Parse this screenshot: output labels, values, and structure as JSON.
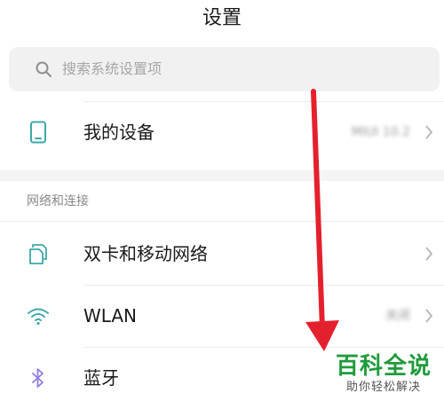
{
  "header": {
    "title": "设置"
  },
  "search": {
    "placeholder": "搜索系统设置项",
    "icon": "search-icon"
  },
  "device_row": {
    "label": "我的设备",
    "value": "MIUI 10.2",
    "icon": "phone-icon"
  },
  "network_section": {
    "header": "网络和连接",
    "items": [
      {
        "label": "双卡和移动网络",
        "value": "",
        "icon": "dual-sim-icon"
      },
      {
        "label": "WLAN",
        "value": "关闭",
        "icon": "wifi-icon"
      },
      {
        "label": "蓝牙",
        "value": "",
        "icon": "bluetooth-icon"
      }
    ]
  },
  "watermark": {
    "main": "百科全说",
    "sub": "助你轻松解决"
  },
  "colors": {
    "icon_teal": "#3fa8a8",
    "bluetooth_purple": "#8c7ee0",
    "arrow_red": "#e5202e",
    "watermark_green": "#1f9b3c"
  }
}
